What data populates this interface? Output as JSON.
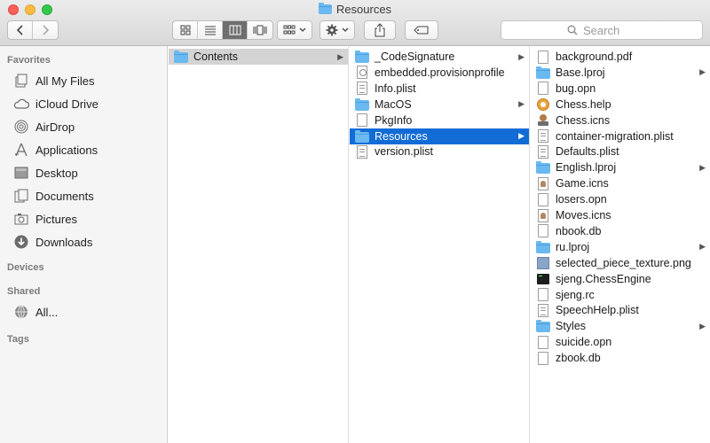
{
  "window": {
    "title": "Resources"
  },
  "toolbar": {
    "back_icon": "chevron-left-icon",
    "forward_icon": "chevron-right-icon",
    "view_modes": [
      "icon-view-icon",
      "list-view-icon",
      "column-view-icon",
      "cover-flow-icon"
    ],
    "active_view": "column-view-icon",
    "arrange_icon": "grid-icon",
    "action_icon": "gear-icon",
    "share_icon": "share-icon",
    "tag_icon": "tag-icon"
  },
  "search": {
    "placeholder": "Search"
  },
  "sidebar": {
    "favorites_heading": "Favorites",
    "favorites": [
      {
        "label": "All My Files",
        "icon": "all-files-icon"
      },
      {
        "label": "iCloud Drive",
        "icon": "cloud-icon"
      },
      {
        "label": "AirDrop",
        "icon": "airdrop-icon"
      },
      {
        "label": "Applications",
        "icon": "applications-icon"
      },
      {
        "label": "Desktop",
        "icon": "desktop-icon"
      },
      {
        "label": "Documents",
        "icon": "documents-icon"
      },
      {
        "label": "Pictures",
        "icon": "camera-icon"
      },
      {
        "label": "Downloads",
        "icon": "download-icon"
      }
    ],
    "devices_heading": "Devices",
    "shared_heading": "Shared",
    "shared": [
      {
        "label": "All...",
        "icon": "network-icon"
      }
    ],
    "tags_heading": "Tags"
  },
  "columns": {
    "col1": [
      {
        "name": "Contents",
        "kind": "folder",
        "has_children": true,
        "selected": "gray"
      }
    ],
    "col2": [
      {
        "name": "_CodeSignature",
        "kind": "folder",
        "has_children": true
      },
      {
        "name": "embedded.provisionprofile",
        "kind": "prov"
      },
      {
        "name": "Info.plist",
        "kind": "plist"
      },
      {
        "name": "MacOS",
        "kind": "folder",
        "has_children": true
      },
      {
        "name": "PkgInfo",
        "kind": "doc"
      },
      {
        "name": "Resources",
        "kind": "folder",
        "has_children": true,
        "selected": "blue"
      },
      {
        "name": "version.plist",
        "kind": "plist"
      }
    ],
    "col3": [
      {
        "name": "background.pdf",
        "kind": "doc"
      },
      {
        "name": "Base.lproj",
        "kind": "folder",
        "has_children": true
      },
      {
        "name": "bug.opn",
        "kind": "doc"
      },
      {
        "name": "Chess.help",
        "kind": "help"
      },
      {
        "name": "Chess.icns",
        "kind": "chess"
      },
      {
        "name": "container-migration.plist",
        "kind": "plist"
      },
      {
        "name": "Defaults.plist",
        "kind": "plist"
      },
      {
        "name": "English.lproj",
        "kind": "folder",
        "has_children": true
      },
      {
        "name": "Game.icns",
        "kind": "icns"
      },
      {
        "name": "losers.opn",
        "kind": "doc"
      },
      {
        "name": "Moves.icns",
        "kind": "icns"
      },
      {
        "name": "nbook.db",
        "kind": "doc"
      },
      {
        "name": "ru.lproj",
        "kind": "folder",
        "has_children": true
      },
      {
        "name": "selected_piece_texture.png",
        "kind": "png"
      },
      {
        "name": "sjeng.ChessEngine",
        "kind": "exec"
      },
      {
        "name": "sjeng.rc",
        "kind": "doc"
      },
      {
        "name": "SpeechHelp.plist",
        "kind": "plist"
      },
      {
        "name": "Styles",
        "kind": "folder",
        "has_children": true
      },
      {
        "name": "suicide.opn",
        "kind": "doc"
      },
      {
        "name": "zbook.db",
        "kind": "doc"
      }
    ]
  },
  "colors": {
    "selection_blue": "#116cd6",
    "selection_gray": "#d4d4d4",
    "folder": "#6ab9f0"
  }
}
